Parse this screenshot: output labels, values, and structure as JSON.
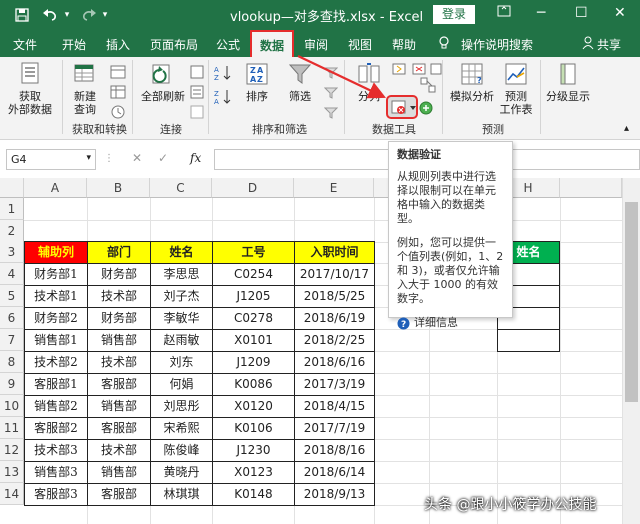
{
  "window": {
    "title": "vlookup—对多查找.xlsx  -  Excel",
    "login_label": "登录",
    "share_label": "共享",
    "tell_me": "操作说明搜索"
  },
  "menu": {
    "items": [
      "文件",
      "开始",
      "插入",
      "页面布局",
      "公式",
      "数据",
      "审阅",
      "视图",
      "帮助"
    ],
    "active": "数据"
  },
  "ribbon": {
    "get_data": [
      "获取",
      "外部数据"
    ],
    "new_query": [
      "新建",
      "查询"
    ],
    "refresh_all": "全部刷新",
    "sort": "排序",
    "filter": "筛选",
    "split": "分列",
    "what_if": "模拟分析",
    "forecast": [
      "预测",
      "工作表"
    ],
    "outline": "分级显示",
    "groups": [
      "获取和转换",
      "连接",
      "排序和筛选",
      "数据工具",
      "预测"
    ]
  },
  "formula_bar": {
    "name_box": "G4",
    "fx": "fx",
    "formula": ""
  },
  "tooltip": {
    "title": "数据验证",
    "para1": "从规则列表中进行选择以限制可以在单元格中输入的数据类型。",
    "para2": "例如，您可以提供一个值列表(例如，1、2 和 3)，或者仅允许输入大于 1000 的有效数字。",
    "more": "详细信息"
  },
  "sheet": {
    "columns": [
      "A",
      "B",
      "C",
      "D",
      "E",
      "F",
      "G",
      "H"
    ],
    "rows": [
      "1",
      "2",
      "3",
      "4",
      "5",
      "6",
      "7",
      "8",
      "9",
      "10",
      "11",
      "12",
      "13",
      "14"
    ],
    "headers": [
      "辅助列",
      "部门",
      "姓名",
      "工号",
      "入职时间"
    ],
    "data": [
      [
        "财务部1",
        "财务部",
        "李思思",
        "C0254",
        "2017/10/17"
      ],
      [
        "技术部1",
        "技术部",
        "刘子杰",
        "J1205",
        "2018/5/25"
      ],
      [
        "财务部2",
        "财务部",
        "李敏华",
        "C0278",
        "2018/6/19"
      ],
      [
        "销售部1",
        "销售部",
        "赵雨敏",
        "X0101",
        "2018/2/25"
      ],
      [
        "技术部2",
        "技术部",
        "刘东",
        "J1209",
        "2018/6/16"
      ],
      [
        "客服部1",
        "客服部",
        "何娟",
        "K0086",
        "2017/3/19"
      ],
      [
        "销售部2",
        "销售部",
        "刘思彤",
        "X0120",
        "2018/4/15"
      ],
      [
        "客服部2",
        "客服部",
        "宋希熙",
        "K0106",
        "2017/7/19"
      ],
      [
        "技术部3",
        "技术部",
        "陈俊峰",
        "J1230",
        "2018/8/16"
      ],
      [
        "销售部3",
        "销售部",
        "黄晓丹",
        "X0123",
        "2018/6/14"
      ],
      [
        "客服部3",
        "客服部",
        "林琪琪",
        "K0148",
        "2018/9/13"
      ]
    ],
    "side_header": "姓名"
  },
  "watermark": "头条 @跟小小筱学办公技能",
  "colors": {
    "excel_green": "#217346",
    "header_yellow": "#ffff00",
    "header_red": "#ff0000",
    "side_green": "#00b050",
    "annotation_red": "#e52d2d"
  }
}
